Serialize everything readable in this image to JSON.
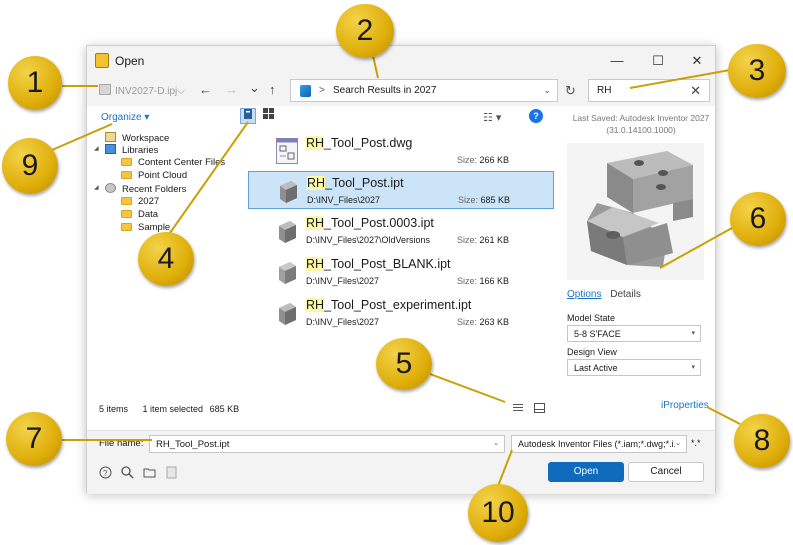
{
  "window": {
    "title": "Open",
    "minimize": "—",
    "maximize": "☐",
    "close": "✕"
  },
  "nav": {
    "project": "INV2027-D.ipj",
    "project_chevron": "⌵",
    "back": "←",
    "forward": "→",
    "recent": "⌄",
    "up": "↑",
    "address_sep": ">",
    "address": "Search Results in 2027",
    "address_dd": "⌄",
    "refresh": "↻",
    "search_value": "RH",
    "search_clear": "✕"
  },
  "toolbar": {
    "organize": "Organize ▾",
    "view_mode_glyph": "☷ ▾",
    "help": "?"
  },
  "tree": [
    {
      "label": "Workspace",
      "icon": "workspace-icon"
    },
    {
      "label": "Libraries",
      "icon": "library-icon",
      "twisty": "◢"
    },
    {
      "label": "Content Center Files",
      "icon": "folder-icon"
    },
    {
      "label": "Point Cloud",
      "icon": "folder-icon"
    },
    {
      "label": "Recent Folders",
      "icon": "recent-icon",
      "twisty": "◢"
    },
    {
      "label": "2027",
      "icon": "folder-icon"
    },
    {
      "label": "Data",
      "icon": "folder-icon"
    },
    {
      "label": "Sample",
      "icon": "folder-icon"
    }
  ],
  "status": {
    "items": "5 items",
    "selected": "1 item selected",
    "size": "685 KB"
  },
  "files": [
    {
      "prefix": "RH",
      "name": "_Tool_Post.dwg",
      "path": "",
      "size_label": "Size:",
      "size": "266 KB",
      "type": "dwg",
      "selected": false
    },
    {
      "prefix": "RH",
      "name": "_Tool_Post.ipt",
      "path": "D:\\INV_Files\\2027",
      "size_label": "Size:",
      "size": "685 KB",
      "type": "ipt",
      "selected": true
    },
    {
      "prefix": "RH",
      "name": "_Tool_Post.0003.ipt",
      "path": "D:\\INV_Files\\2027\\OldVersions",
      "size_label": "Size:",
      "size": "261 KB",
      "type": "ipt",
      "selected": false
    },
    {
      "prefix": "RH",
      "name": "_Tool_Post_BLANK.ipt",
      "path": "D:\\INV_Files\\2027",
      "size_label": "Size:",
      "size": "166 KB",
      "type": "ipt",
      "selected": false
    },
    {
      "prefix": "RH",
      "name": "_Tool_Post_experiment.ipt",
      "path": "D:\\INV_Files\\2027",
      "size_label": "Size:",
      "size": "263 KB",
      "type": "ipt",
      "selected": false
    }
  ],
  "preview": {
    "last_saved": "Last Saved: Autodesk Inventor 2027",
    "version": "(31.0.14100.1000)",
    "tab_options": "Options",
    "tab_details": "Details",
    "model_state_label": "Model State",
    "model_state_value": "5-8 S'FACE",
    "design_view_label": "Design View",
    "design_view_value": "Last Active",
    "iproperties": "iProperties",
    "dd": "▾"
  },
  "bottom": {
    "filename_label": "File name:",
    "filename_value": "RH_Tool_Post.ipt",
    "filetype_value": "Autodesk Inventor Files (*.iam;*.dwg;*.i...",
    "star": "*.*",
    "open": "Open",
    "cancel": "Cancel",
    "dd": "⌄"
  },
  "callouts": [
    "1",
    "2",
    "3",
    "4",
    "5",
    "6",
    "7",
    "8",
    "9",
    "10"
  ],
  "colors": {
    "accent": "#0f6cbd",
    "selection": "#cce4f7",
    "highlight": "#fdf8a8",
    "callout": "#e2b20f",
    "leader": "#c9a006"
  }
}
